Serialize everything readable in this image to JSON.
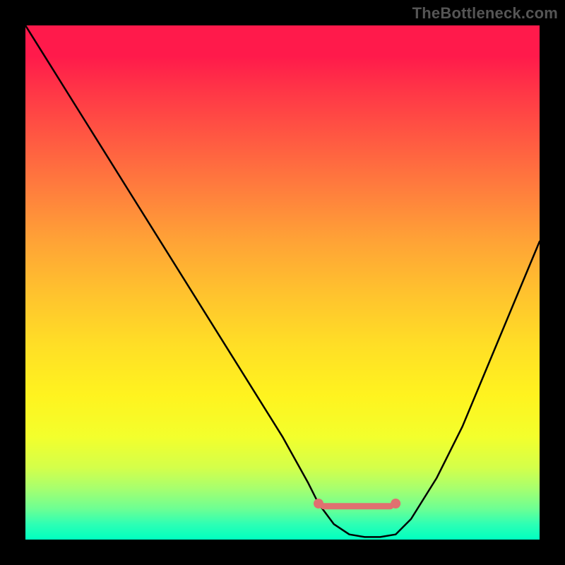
{
  "watermark": "TheBottleneck.com",
  "chart_data": {
    "type": "line",
    "title": "",
    "xlabel": "",
    "ylabel": "",
    "xlim": [
      0,
      100
    ],
    "ylim": [
      0,
      100
    ],
    "series": [
      {
        "name": "bottleneck-curve",
        "x": [
          0,
          5,
          10,
          15,
          20,
          25,
          30,
          35,
          40,
          45,
          50,
          55,
          57,
          60,
          63,
          66,
          69,
          72,
          75,
          80,
          85,
          90,
          95,
          100
        ],
        "y": [
          100,
          92,
          84,
          76,
          68,
          60,
          52,
          44,
          36,
          28,
          20,
          11,
          7,
          3,
          1,
          0.5,
          0.5,
          1,
          4,
          12,
          22,
          34,
          46,
          58
        ]
      }
    ],
    "markers": [
      {
        "name": "range-start",
        "x": 57,
        "y": 7,
        "color": "#e07070"
      },
      {
        "name": "range-end",
        "x": 72,
        "y": 7,
        "color": "#e07070"
      }
    ],
    "optimal_band": {
      "x_start": 58,
      "x_end": 71,
      "y": 6.5,
      "color": "#e07070"
    },
    "background": {
      "type": "vertical-gradient",
      "stops": [
        {
          "pos": 0,
          "color": "#ff1a4b"
        },
        {
          "pos": 50,
          "color": "#ffc22e"
        },
        {
          "pos": 80,
          "color": "#f3ff2c"
        },
        {
          "pos": 100,
          "color": "#00ffc0"
        }
      ]
    }
  }
}
